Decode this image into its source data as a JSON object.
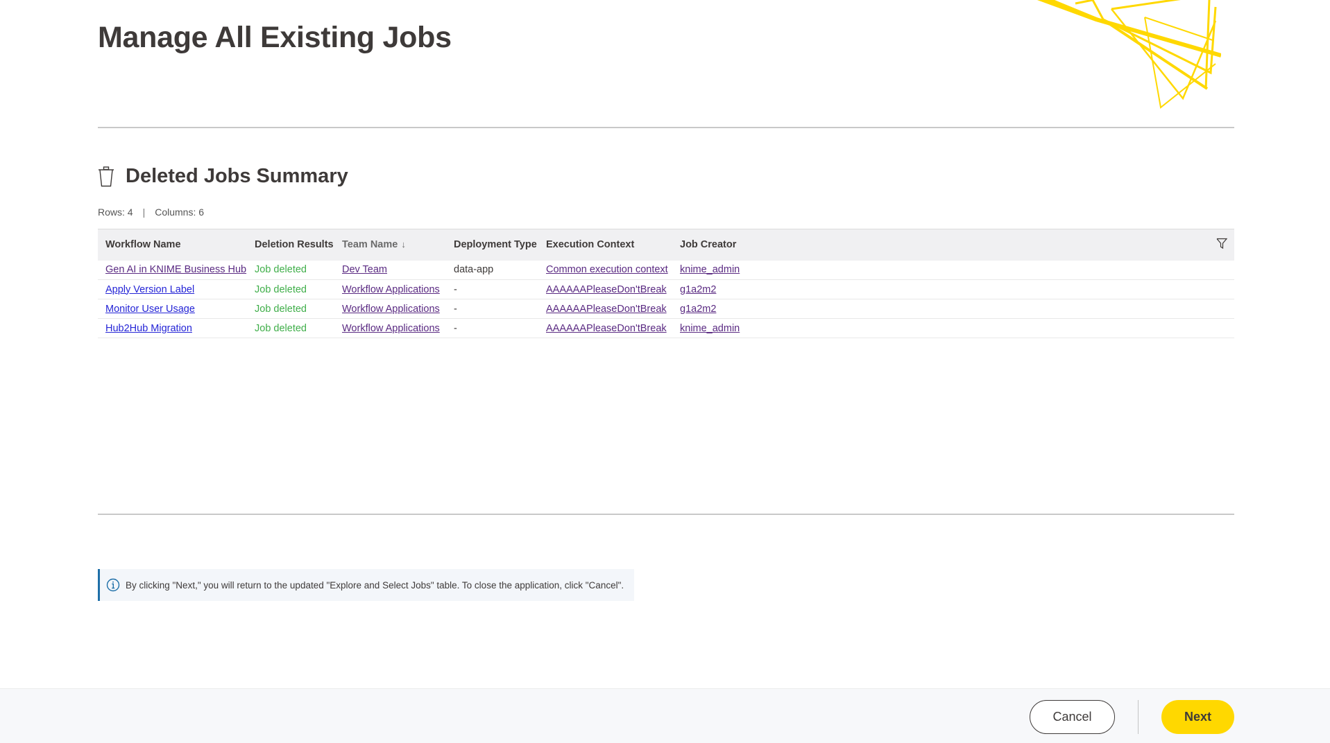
{
  "header": {
    "title": "Manage All Existing Jobs",
    "logo_icon": "knime-decorative-triangles-icon"
  },
  "section": {
    "icon": "trash-icon",
    "title": "Deleted Jobs Summary",
    "rows_label": "Rows: 4",
    "separator": "|",
    "columns_label": "Columns: 6"
  },
  "table": {
    "columns": [
      {
        "label": "Workflow Name"
      },
      {
        "label": "Deletion Results"
      },
      {
        "label": "Team Name",
        "sort": "descending",
        "sort_icon": "arrow-down-icon"
      },
      {
        "label": "Deployment Type"
      },
      {
        "label": "Execution Context"
      },
      {
        "label": "Job Creator"
      }
    ],
    "filter_icon": "filter-icon",
    "rows": [
      {
        "workflow": "Gen AI in KNIME Business Hub",
        "result": "Job deleted",
        "team": "Dev Team",
        "deployment": "data-app",
        "context": "Common execution context",
        "creator": "knime_admin"
      },
      {
        "workflow": "Apply Version Label",
        "result": "Job deleted",
        "team": "Workflow Applications",
        "deployment": "-",
        "context": "AAAAAAPleaseDon'tBreak",
        "creator": "g1a2m2"
      },
      {
        "workflow": "Monitor User Usage",
        "result": "Job deleted",
        "team": "Workflow Applications",
        "deployment": "-",
        "context": "AAAAAAPleaseDon'tBreak",
        "creator": "g1a2m2"
      },
      {
        "workflow": "Hub2Hub Migration",
        "result": "Job deleted",
        "team": "Workflow Applications",
        "deployment": "-",
        "context": "AAAAAAPleaseDon'tBreak",
        "creator": "knime_admin"
      }
    ]
  },
  "info": {
    "icon": "info-icon",
    "text": "By clicking \"Next,\" you will return to the updated \"Explore and Select Jobs\" table. To close the application, click \"Cancel\"."
  },
  "footer": {
    "cancel_label": "Cancel",
    "next_label": "Next"
  },
  "colors": {
    "accent": "#ffd800",
    "success": "#3fae49",
    "info_border": "#1e6fa8",
    "link_visited": "#5a2a82",
    "link": "#2424d6"
  }
}
